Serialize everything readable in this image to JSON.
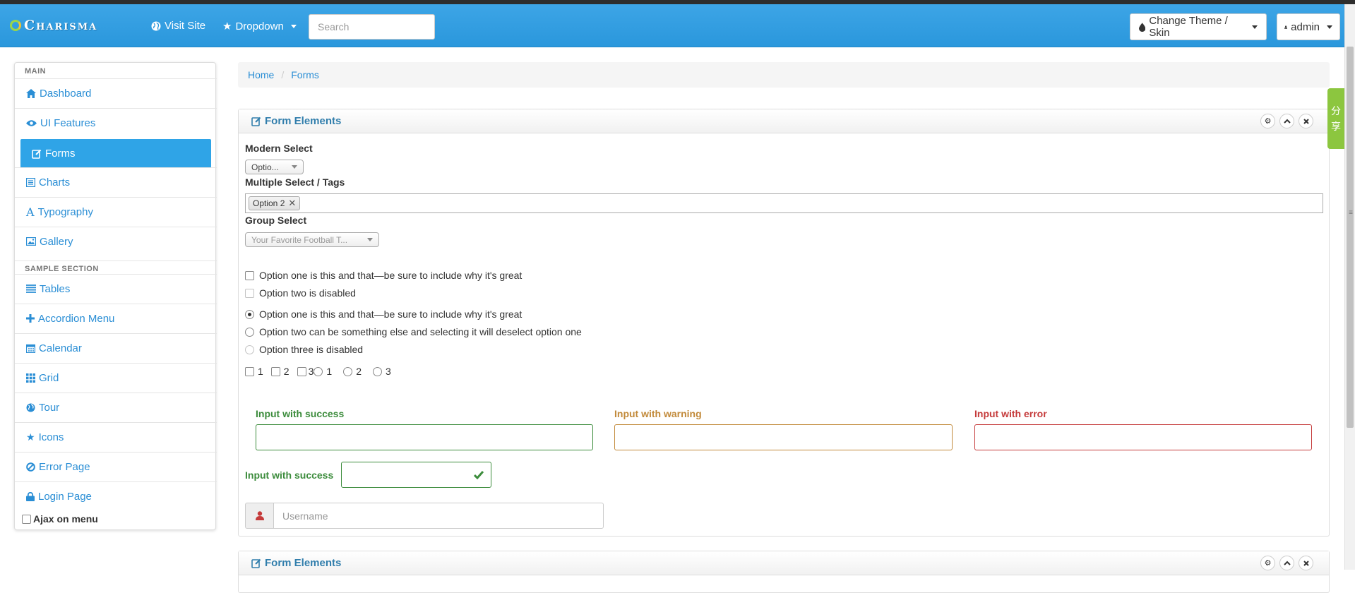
{
  "navbar": {
    "brand": "Charisma",
    "visit_site": "Visit Site",
    "dropdown": "Dropdown",
    "search_placeholder": "Search",
    "theme_button": "Change Theme / Skin",
    "user_button": "admin"
  },
  "sidebar": {
    "main_header": "MAIN",
    "main_items": [
      {
        "label": "Dashboard",
        "icon": "home-icon"
      },
      {
        "label": "UI Features",
        "icon": "eye-icon"
      },
      {
        "label": "Forms",
        "icon": "edit-icon",
        "active": true
      },
      {
        "label": "Charts",
        "icon": "list-alt-icon"
      },
      {
        "label": "Typography",
        "icon": "font-icon"
      },
      {
        "label": "Gallery",
        "icon": "picture-icon"
      }
    ],
    "sample_header": "SAMPLE SECTION",
    "sample_items": [
      {
        "label": "Tables",
        "icon": "align-justify-icon"
      },
      {
        "label": "Accordion Menu",
        "icon": "plus-icon"
      },
      {
        "label": "Calendar",
        "icon": "calendar-icon"
      },
      {
        "label": "Grid",
        "icon": "th-icon"
      },
      {
        "label": "Tour",
        "icon": "globe-icon"
      },
      {
        "label": "Icons",
        "icon": "star-icon"
      },
      {
        "label": "Error Page",
        "icon": "ban-icon"
      },
      {
        "label": "Login Page",
        "icon": "lock-icon"
      }
    ],
    "ajax_label": "Ajax on menu"
  },
  "breadcrumb": {
    "home": "Home",
    "current": "Forms"
  },
  "share_tab": [
    "分",
    "享"
  ],
  "form_box": {
    "title": "Form Elements",
    "modern_select_label": "Modern Select",
    "modern_select_value": "Optio...",
    "multi_select_label": "Multiple Select / Tags",
    "multi_select_tag": "Option 2",
    "group_select_label": "Group Select",
    "group_select_value": "Your Favorite Football T...",
    "checkbox_one": "Option one is this and that—be sure to include why it's great",
    "checkbox_two": "Option two is disabled",
    "radio_one": "Option one is this and that—be sure to include why it's great",
    "radio_two": "Option two can be something else and selecting it will deselect option one",
    "radio_three": "Option three is disabled",
    "inline_checkboxes": [
      "1",
      "2",
      "3"
    ],
    "inline_radios": [
      "1",
      "2",
      "3"
    ],
    "success_label": "Input with success",
    "warning_label": "Input with warning",
    "error_label": "Input with error",
    "success_inline_label": "Input with success",
    "username_placeholder": "Username"
  },
  "form_box_2": {
    "title": "Form Elements"
  },
  "colors": {
    "navbar": "#2a97dc",
    "active_item": "#2fa4e7",
    "link": "#2a8ed5",
    "success": "#3c8c3c",
    "warning": "#c28a3a",
    "error": "#c53b3b",
    "share": "#8cc63f"
  }
}
